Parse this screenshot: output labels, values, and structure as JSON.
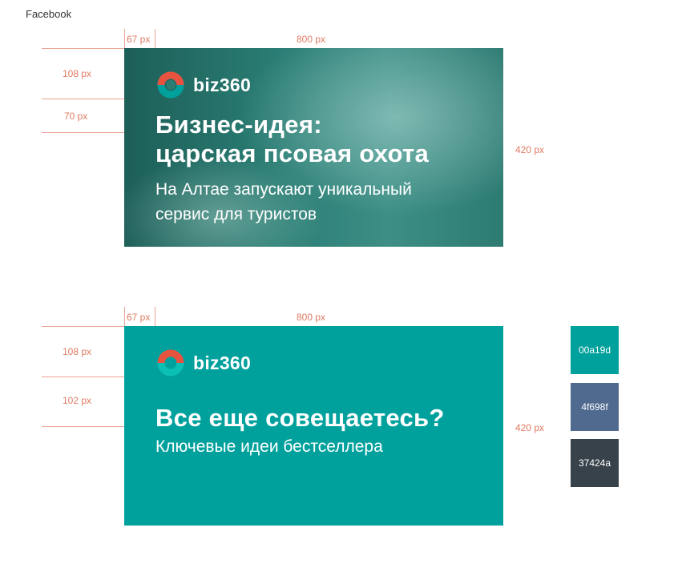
{
  "page": {
    "label": "Facebook"
  },
  "banner_photo": {
    "brand": "biz360",
    "title_line1": "Бизнес-идея:",
    "title_line2": "царская псовая охота",
    "subtitle_line1": "На Алтае запускают уникальный",
    "subtitle_line2": "сервис для туристов",
    "dims": {
      "left_margin": "67 px",
      "width": "800 px",
      "height": "420 px",
      "logo_top": "108 px",
      "title_offset": "70 px"
    }
  },
  "banner_plain": {
    "brand": "biz360",
    "title": "Все еще совещаетесь?",
    "subtitle": "Ключевые идеи бестселлера",
    "dims": {
      "left_margin": "67 px",
      "width": "800 px",
      "height": "420 px",
      "logo_top": "108 px",
      "title_offset": "102 px"
    }
  },
  "palette": [
    {
      "label": "00a19d",
      "color": "#00a19d"
    },
    {
      "label": "4f698f",
      "color": "#4f698f"
    },
    {
      "label": "37424a",
      "color": "#37424a"
    }
  ],
  "colors": {
    "logo_teal": "#00a19d",
    "logo_red": "#e8533f"
  }
}
